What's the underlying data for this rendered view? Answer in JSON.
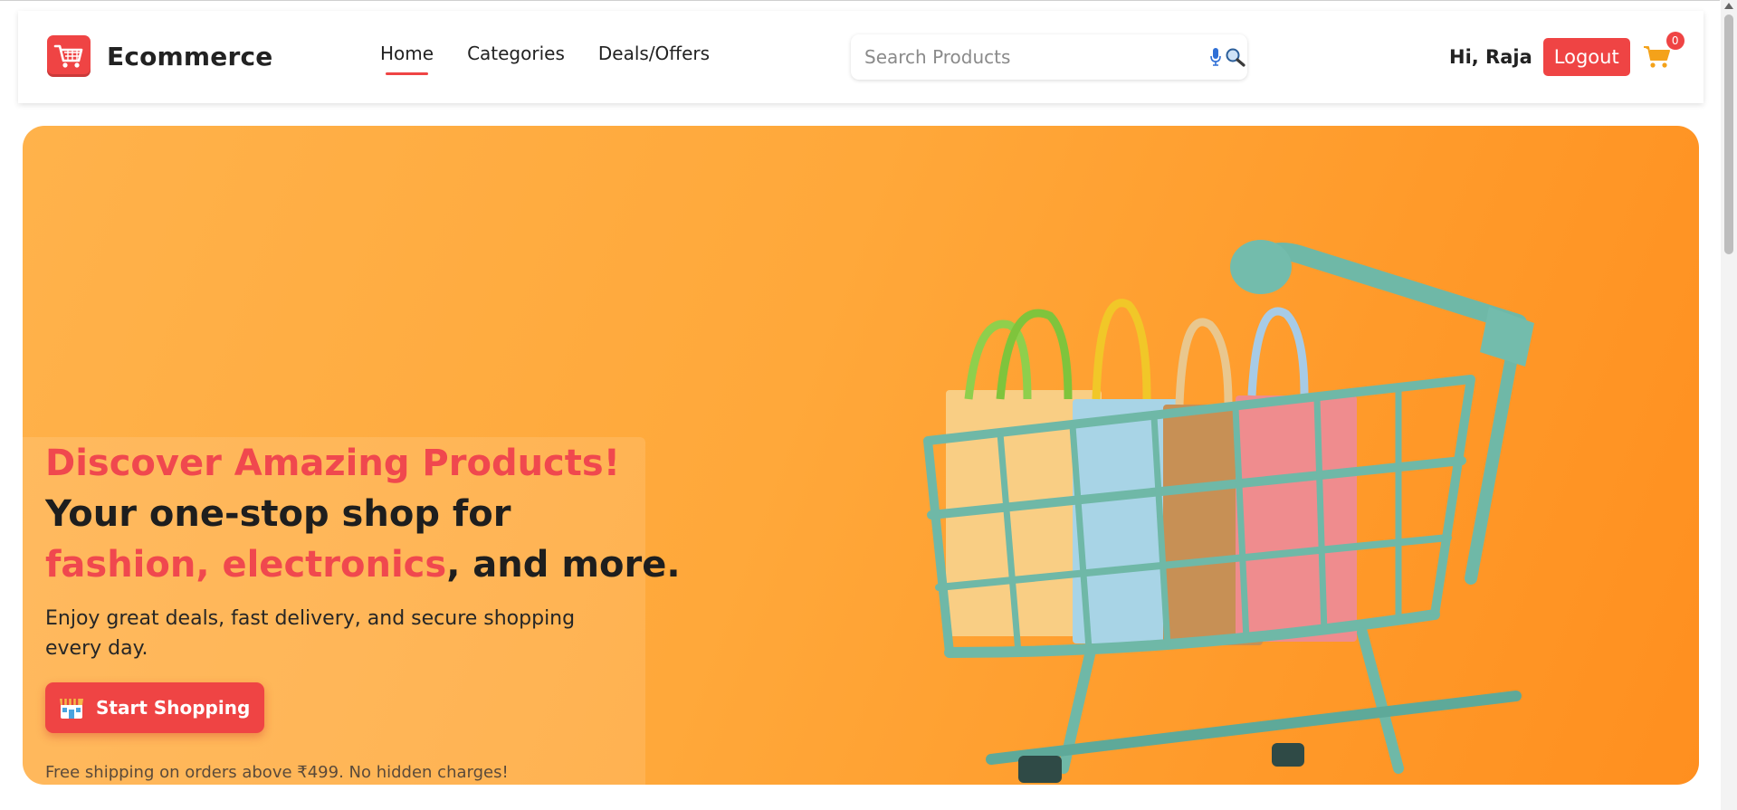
{
  "colors": {
    "accent": "#ef4444",
    "hero_bg": "#ffa83a",
    "cart_icon": "#f4a21a"
  },
  "navbar": {
    "brand": {
      "name": "Ecommerce",
      "icon": "shopping-cart-icon"
    },
    "links": [
      {
        "label": "Home",
        "active": true
      },
      {
        "label": "Categories",
        "active": false
      },
      {
        "label": "Deals/Offers",
        "active": false
      }
    ],
    "search": {
      "placeholder": "Search Products",
      "value": "",
      "icons": [
        "microphone-icon",
        "search-icon"
      ]
    },
    "user": {
      "greeting": "Hi, Raja",
      "logout_label": "Logout"
    },
    "cart": {
      "icon": "cart-icon",
      "count": "0"
    }
  },
  "hero": {
    "title_line1": "Discover Amazing Products!",
    "title_line2": "Your one-stop shop for",
    "title_line3_accent": "fashion, electronics",
    "title_line3_rest": ", and more.",
    "description": "Enjoy great deals, fast delivery, and secure shopping every day.",
    "cta_label": "Start Shopping",
    "cta_icon": "store-icon",
    "note": "Free shipping on orders above ₹499. No hidden charges!"
  }
}
